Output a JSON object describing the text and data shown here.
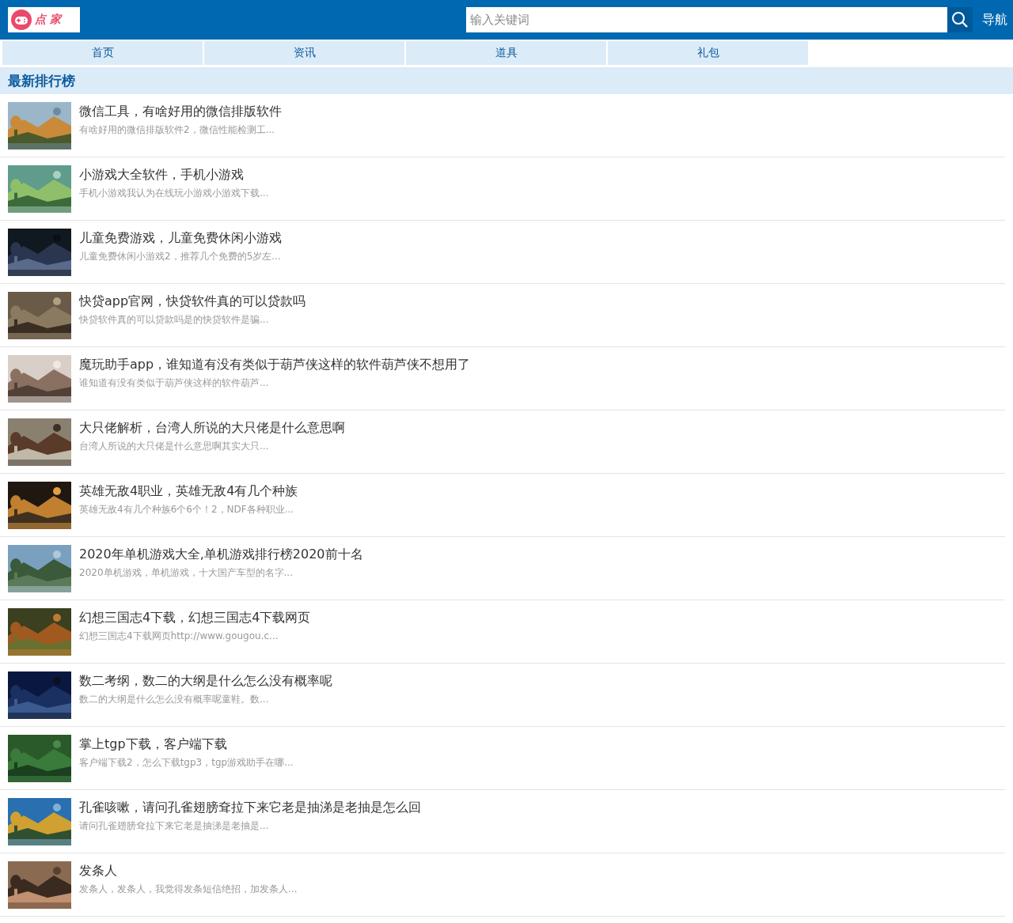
{
  "header": {
    "logo": "点 家",
    "search": {
      "placeholder": "输入关键词"
    },
    "nav_link": "导航"
  },
  "tabs": [
    {
      "label": "首页"
    },
    {
      "label": "资讯"
    },
    {
      "label": "道具"
    },
    {
      "label": "礼包"
    }
  ],
  "section_title": "最新排行榜",
  "articles": [
    {
      "title": "微信工具，有啥好用的微信排版软件",
      "summary": "有啥好用的微信排版软件2，微信性能检测工..."
    },
    {
      "title": "小游戏大全软件，手机小游戏",
      "summary": "手机小游戏我认为在线玩小游戏小游戏下载..."
    },
    {
      "title": "儿童免费游戏，儿童免费休闲小游戏",
      "summary": "儿童免费休闲小游戏2，推荐几个免费的5岁左..."
    },
    {
      "title": "快贷app官网，快贷软件真的可以贷款吗",
      "summary": "快贷软件真的可以贷款吗是的快贷软件是骗..."
    },
    {
      "title": "魔玩助手app，谁知道有没有类似于葫芦侠这样的软件葫芦侠不想用了",
      "summary": "谁知道有没有类似于葫芦侠这样的软件葫芦..."
    },
    {
      "title": "大只佬解析，台湾人所说的大只佬是什么意思啊",
      "summary": "台湾人所说的大只佬是什么意思啊其实大只..."
    },
    {
      "title": "英雄无敌4职业，英雄无敌4有几个种族",
      "summary": "英雄无敌4有几个种族6个6个！2，NDF各种职业..."
    },
    {
      "title": "2020年单机游戏大全,单机游戏排行榜2020前十名",
      "summary": "2020单机游戏，单机游戏，十大国产车型的名字..."
    },
    {
      "title": "幻想三国志4下载，幻想三国志4下载网页",
      "summary": "幻想三国志4下载网页http://www.gougou.c..."
    },
    {
      "title": "数二考纲，数二的大纲是什么怎么没有概率呢",
      "summary": "数二的大纲是什么怎么没有概率呢童鞋。数..."
    },
    {
      "title": "掌上tgp下载，客户端下载",
      "summary": "客户端下载2，怎么下载tgp3，tgp游戏助手在哪..."
    },
    {
      "title": "孔雀咳嗽，请问孔雀翅膀耷拉下来它老是抽涕是老抽是怎么回",
      "summary": "请问孔雀翅膀耷拉下来它老是抽涕是老抽是..."
    },
    {
      "title": "发条人",
      "summary": "发条人，发条人，我觉得发条短信绝招，加发条人..."
    }
  ]
}
